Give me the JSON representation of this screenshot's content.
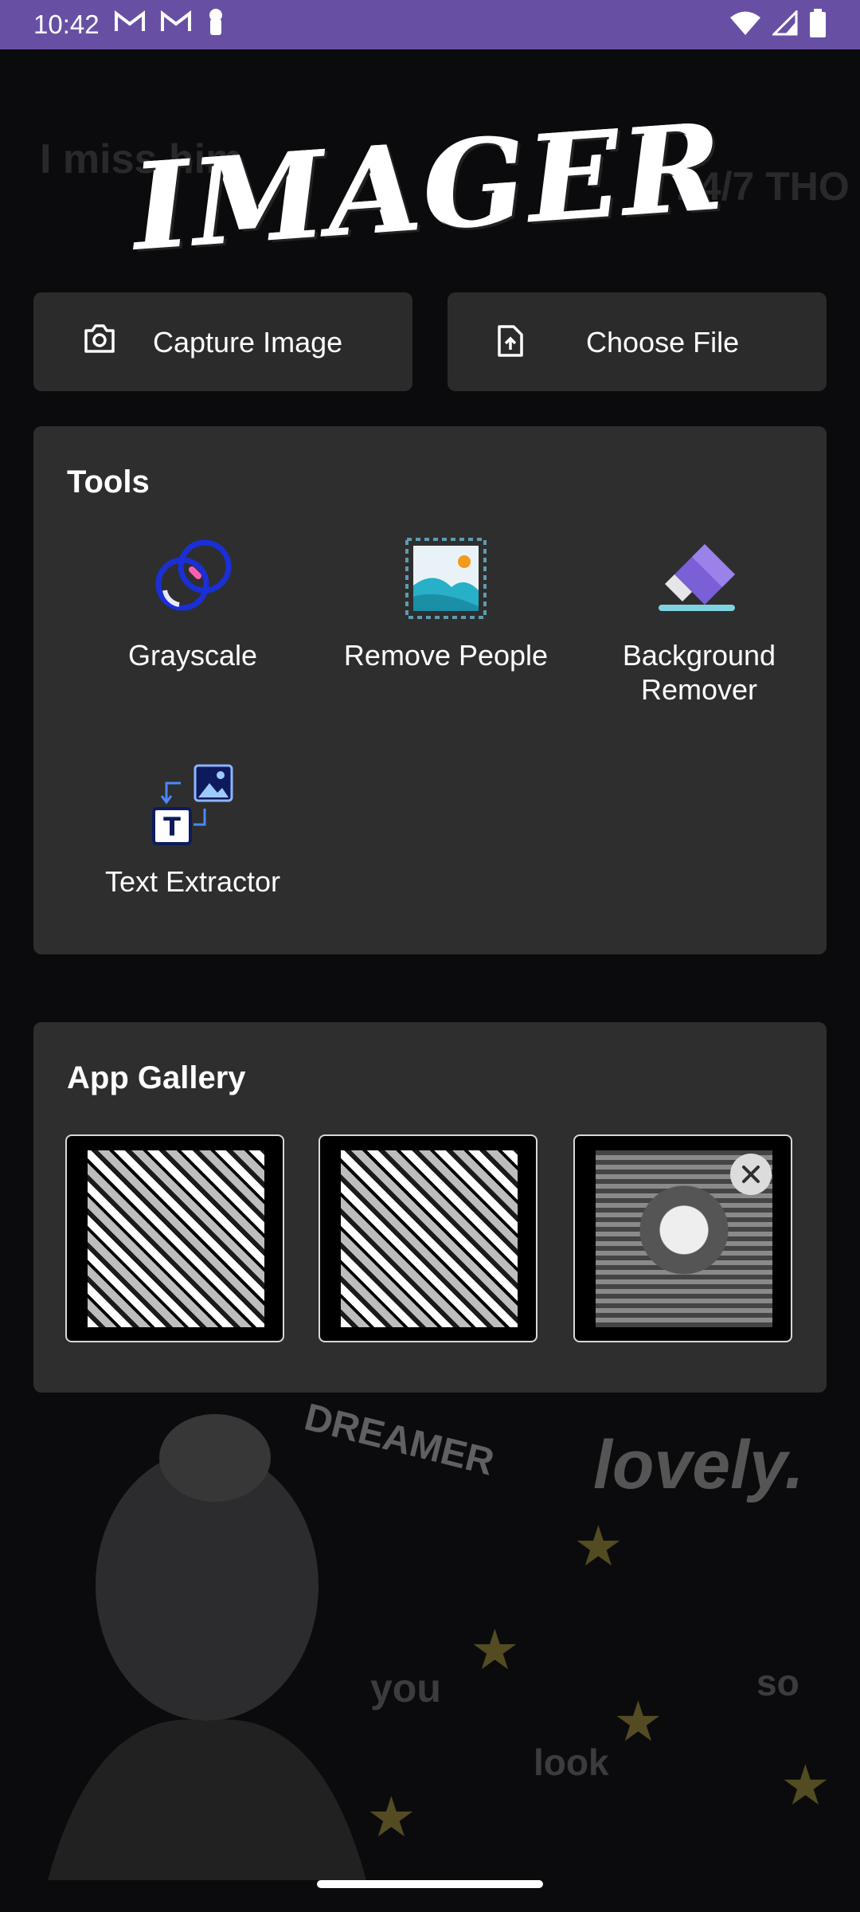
{
  "status_bar": {
    "time": "10:42",
    "icons": [
      "gmail-icon",
      "gmail-icon",
      "keyhole-icon",
      "wifi-icon",
      "signal-icon",
      "battery-icon"
    ]
  },
  "logo_text": "IMAGER",
  "actions": {
    "capture_label": "Capture Image",
    "choose_label": "Choose File"
  },
  "tools": {
    "title": "Tools",
    "items": [
      {
        "label": "Grayscale",
        "icon": "grayscale-icon"
      },
      {
        "label": "Remove People",
        "icon": "remove-people-icon"
      },
      {
        "label": "Background Remover",
        "icon": "eraser-icon"
      },
      {
        "label": "Text Extractor",
        "icon": "text-extractor-icon"
      }
    ]
  },
  "gallery": {
    "title": "App Gallery",
    "items": [
      {
        "icon": "gallery-thumbnail"
      },
      {
        "icon": "gallery-thumbnail"
      },
      {
        "icon": "gallery-thumbnail",
        "removable": true
      }
    ]
  },
  "background_text": [
    "I miss him",
    "24/7 THO",
    "DREAMER",
    "lovely.",
    "you",
    "look",
    "so"
  ],
  "colors": {
    "status_bar": "#6750a4",
    "card": "#2e2e2e",
    "button": "#2b2b2b",
    "accent_blue": "#1a2fd6",
    "accent_pink": "#ff5fb0"
  }
}
